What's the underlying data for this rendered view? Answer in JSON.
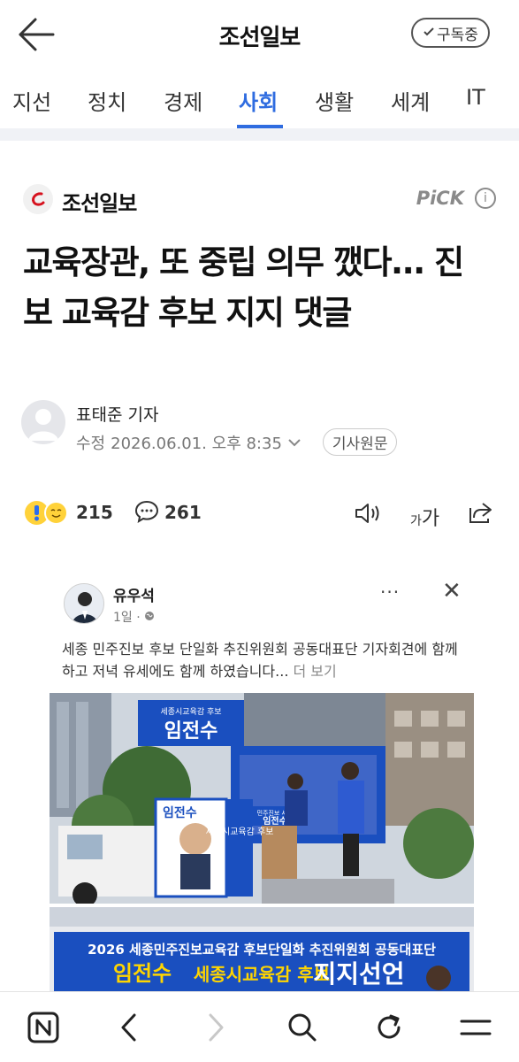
{
  "header": {
    "title": "조선일보",
    "subscribe_label": "구독중"
  },
  "tabs": [
    {
      "label": "지선"
    },
    {
      "label": "정치"
    },
    {
      "label": "경제"
    },
    {
      "label": "사회",
      "active": true
    },
    {
      "label": "생활"
    },
    {
      "label": "세계"
    },
    {
      "label": "IT"
    }
  ],
  "article": {
    "press_name": "조선일보",
    "pick_label": "PiCK",
    "pick_info": "i",
    "headline": "교육장관, 또 중립 의무 깼다... 진보 교육감 후보 지지 댓글",
    "reporter": "표태준 기자",
    "modified_label": "수정",
    "modified_time": "2026.06.01. 오후 8:35",
    "original_button": "기사원문",
    "reaction_count": "215",
    "comment_count": "261",
    "font_size_label_small": "가",
    "font_size_label_large": "가"
  },
  "post": {
    "author": "유우석",
    "time": "1일 · ",
    "more": "···",
    "close": "✕",
    "text": "세종 민주진보 후보 단일화 추진위원회 공동대표단 기자회견에 함께 하고 저녁 유세에도 함께 하였습니다... ",
    "see_more": "더 보기",
    "photo1": {
      "sign_top_small": "세종시교육감 후보",
      "sign_top_name": "임전수",
      "truck_name": "임전수",
      "truck_vertical": "세종시교육감 후보",
      "podium_small": "민주진보 세종",
      "podium_name": "임전수"
    },
    "photo2": {
      "banner_line1": "2026 세종민주진보교육감 후보단일화 추진위원회 공동대표단",
      "banner_line2_name": "임전수",
      "banner_line2_mid": "세종시교육감 후보",
      "banner_line2_end": "지지선언"
    }
  },
  "colors": {
    "accent": "#2f6ce0",
    "press_red": "#d6121e",
    "campaign_blue": "#1a4fbf"
  }
}
